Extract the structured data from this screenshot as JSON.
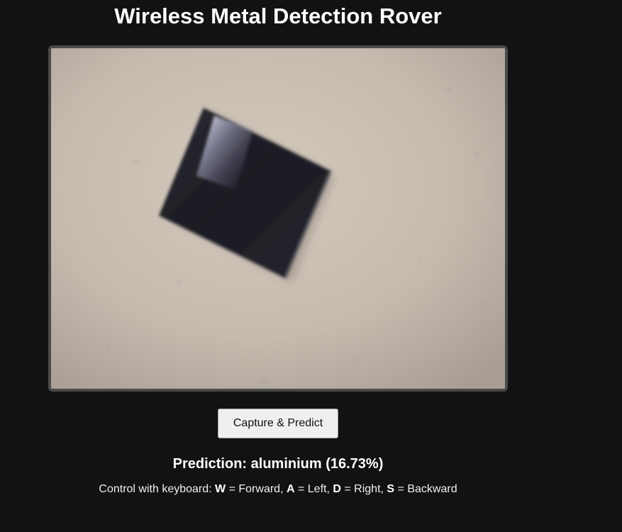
{
  "page": {
    "title": "Wireless Metal Detection Rover"
  },
  "camera_feed": {
    "image_description_icon": "camera-feed-image"
  },
  "actions": {
    "capture_label": "Capture & Predict"
  },
  "prediction": {
    "text": "Prediction: aluminium (16.73%)"
  },
  "controls": {
    "intro": "Control with keyboard:",
    "keys": [
      {
        "key": "W",
        "action": "= Forward,"
      },
      {
        "key": "A",
        "action": "= Left,"
      },
      {
        "key": "D",
        "action": "= Right,"
      },
      {
        "key": "S",
        "action": "= Backward"
      }
    ]
  },
  "colors": {
    "background": "#121212",
    "frame_border": "#4a4a4a",
    "button_bg": "#efefef"
  }
}
